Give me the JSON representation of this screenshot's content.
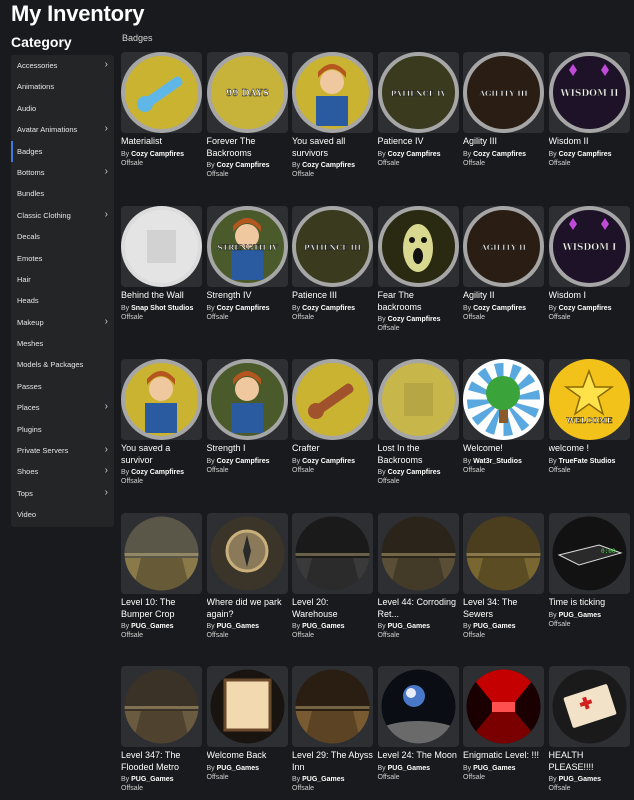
{
  "page": {
    "title": "My Inventory",
    "category_heading": "Category",
    "section_label": "Badges"
  },
  "categories": [
    {
      "label": "Accessories",
      "chevron": true
    },
    {
      "label": "Animations",
      "chevron": false
    },
    {
      "label": "Audio",
      "chevron": false
    },
    {
      "label": "Avatar Animations",
      "chevron": true
    },
    {
      "label": "Badges",
      "chevron": false,
      "active": true
    },
    {
      "label": "Bottoms",
      "chevron": true
    },
    {
      "label": "Bundles",
      "chevron": false
    },
    {
      "label": "Classic Clothing",
      "chevron": true
    },
    {
      "label": "Decals",
      "chevron": false
    },
    {
      "label": "Emotes",
      "chevron": false
    },
    {
      "label": "Hair",
      "chevron": false
    },
    {
      "label": "Heads",
      "chevron": false
    },
    {
      "label": "Makeup",
      "chevron": true
    },
    {
      "label": "Meshes",
      "chevron": false
    },
    {
      "label": "Models & Packages",
      "chevron": false
    },
    {
      "label": "Passes",
      "chevron": false
    },
    {
      "label": "Places",
      "chevron": true
    },
    {
      "label": "Plugins",
      "chevron": false
    },
    {
      "label": "Private Servers",
      "chevron": true
    },
    {
      "label": "Shoes",
      "chevron": true
    },
    {
      "label": "Tops",
      "chevron": true
    },
    {
      "label": "Video",
      "chevron": false
    }
  ],
  "labels": {
    "by_prefix": "By",
    "chevron_glyph": "›"
  },
  "badges": [
    {
      "name": "Materialist",
      "creator": "Cozy Campfires",
      "status": "Offsale",
      "icon": "wrench-badge-icon",
      "art": {
        "type": "wrench",
        "ring": "#a6a6a6"
      }
    },
    {
      "name": "Forever The Backrooms",
      "creator": "Cozy Campfires",
      "status": "Offsale",
      "icon": "99-days-badge-icon",
      "art": {
        "type": "text",
        "text": "99 DAYS",
        "bg": "#c7b23a",
        "ring": "#a6a6a6"
      }
    },
    {
      "name": "You saved all survivors",
      "creator": "Cozy Campfires",
      "status": "Offsale",
      "icon": "survivor-badge-icon",
      "art": {
        "type": "avatar",
        "bg": "#c9b331",
        "ring": "#a6a6a6"
      }
    },
    {
      "name": "Patience IV",
      "creator": "Cozy Campfires",
      "status": "Offsale",
      "icon": "patience-badge-icon",
      "art": {
        "type": "text",
        "text": "PATIENCE IV",
        "bg": "#3a3a1e",
        "ring": "#a6a6a6"
      }
    },
    {
      "name": "Agility III",
      "creator": "Cozy Campfires",
      "status": "Offsale",
      "icon": "agility-badge-icon",
      "art": {
        "type": "text",
        "text": "AGILITY III",
        "bg": "#2a1e14",
        "ring": "#a6a6a6"
      }
    },
    {
      "name": "Wisdom II",
      "creator": "Cozy Campfires",
      "status": "Offsale",
      "icon": "wisdom-badge-icon",
      "art": {
        "type": "text",
        "text": "WISDOM II",
        "bg": "#1e1228",
        "ring": "#a6a6a6",
        "gems": true
      }
    },
    {
      "name": "Behind the Wall",
      "creator": "Snap Shot Studios",
      "status": "Offsale",
      "icon": "wall-badge-icon",
      "art": {
        "type": "plain",
        "bg": "#e4e4e4",
        "ring": "#dcdcdc"
      }
    },
    {
      "name": "Strength IV",
      "creator": "Cozy Campfires",
      "status": "Offsale",
      "icon": "strength-badge-icon",
      "art": {
        "type": "avatartext",
        "text": "STRENGTH IV",
        "bg": "#4a5a2a",
        "ring": "#a6a6a6"
      }
    },
    {
      "name": "Patience III",
      "creator": "Cozy Campfires",
      "status": "Offsale",
      "icon": "patience-badge-icon",
      "art": {
        "type": "text",
        "text": "PATIENCE III",
        "bg": "#3a3a1e",
        "ring": "#a6a6a6"
      }
    },
    {
      "name": "Fear The backrooms",
      "creator": "Cozy Campfires",
      "status": "Offsale",
      "icon": "monster-badge-icon",
      "art": {
        "type": "monster",
        "bg": "#2a2a12",
        "ring": "#a6a6a6"
      }
    },
    {
      "name": "Agility II",
      "creator": "Cozy Campfires",
      "status": "Offsale",
      "icon": "agility-badge-icon",
      "art": {
        "type": "text",
        "text": "AGILITY II",
        "bg": "#2a1e14",
        "ring": "#a6a6a6"
      }
    },
    {
      "name": "Wisdom I",
      "creator": "Cozy Campfires",
      "status": "Offsale",
      "icon": "wisdom-badge-icon",
      "art": {
        "type": "text",
        "text": "WISDOM I",
        "bg": "#1e1228",
        "ring": "#a6a6a6",
        "gems": true
      }
    },
    {
      "name": "You saved a survivor",
      "creator": "Cozy Campfires",
      "status": "Offsale",
      "icon": "survivor-badge-icon",
      "art": {
        "type": "avatar",
        "bg": "#c9b331",
        "ring": "#a6a6a6"
      }
    },
    {
      "name": "Strength I",
      "creator": "Cozy Campfires",
      "status": "Offsale",
      "icon": "strength-badge-icon",
      "art": {
        "type": "avatar",
        "bg": "#4a5a2a",
        "ring": "#a6a6a6"
      }
    },
    {
      "name": "Crafter",
      "creator": "Cozy Campfires",
      "status": "Offsale",
      "icon": "crafter-badge-icon",
      "art": {
        "type": "wrench",
        "bg": "#c9b331",
        "ring": "#a6a6a6",
        "tool": "#a0522d"
      }
    },
    {
      "name": "Lost In the Backrooms",
      "creator": "Cozy Campfires",
      "status": "Offsale",
      "icon": "backrooms-badge-icon",
      "art": {
        "type": "plain",
        "bg": "#c7b64a",
        "ring": "#a6a6a6"
      }
    },
    {
      "name": "Welcome!",
      "creator": "Wat3r_Studios",
      "status": "Offsale",
      "icon": "tree-badge-icon",
      "art": {
        "type": "tree",
        "bg": "#5aa8e0",
        "ring": "#ffffff"
      }
    },
    {
      "name": "welcome !",
      "creator": "TrueFate Studios",
      "status": "Offsale",
      "icon": "star-badge-icon",
      "art": {
        "type": "star",
        "text": "WELCOME",
        "bg": "#f2c21b",
        "ring": "#f2c21b"
      }
    },
    {
      "name": "Level 10: The Bumper Crop",
      "creator": "PUG_Games",
      "status": "Offsale",
      "icon": "field-badge-icon",
      "art": {
        "type": "scene",
        "sky": "#5a5648",
        "ground": "#8a7a4a"
      }
    },
    {
      "name": "Where did we park again?",
      "creator": "PUG_Games",
      "status": "Offsale",
      "icon": "compass-badge-icon",
      "art": {
        "type": "compass",
        "bg": "#3a3528"
      }
    },
    {
      "name": "Level 20: Warehouse",
      "creator": "PUG_Games",
      "status": "Offsale",
      "icon": "warehouse-badge-icon",
      "art": {
        "type": "scene",
        "sky": "#1a1a1a",
        "ground": "#3a3a3a"
      }
    },
    {
      "name": "Level 44: Corroding Ret...",
      "creator": "PUG_Games",
      "status": "Offsale",
      "icon": "hall-badge-icon",
      "art": {
        "type": "scene",
        "sky": "#2a241a",
        "ground": "#5a4e36"
      }
    },
    {
      "name": "Level 34: The Sewers",
      "creator": "PUG_Games",
      "status": "Offsale",
      "icon": "sewer-badge-icon",
      "art": {
        "type": "scene",
        "sky": "#4a3e1e",
        "ground": "#7a6630"
      }
    },
    {
      "name": "Time is ticking",
      "creator": "PUG_Games",
      "status": "Offsale",
      "icon": "clock-badge-icon",
      "art": {
        "type": "timer",
        "bg": "#121212"
      }
    },
    {
      "name": "Level 347: The Flooded Metro",
      "creator": "PUG_Games",
      "status": "Offsale",
      "icon": "metro-badge-icon",
      "art": {
        "type": "scene",
        "sky": "#3a3226",
        "ground": "#6a5a40"
      }
    },
    {
      "name": "Welcome Back",
      "creator": "PUG_Games",
      "status": "Offsale",
      "icon": "doorway-badge-icon",
      "art": {
        "type": "door",
        "bg": "#1a1410"
      }
    },
    {
      "name": "Level 29: The Abyss Inn",
      "creator": "PUG_Games",
      "status": "Offsale",
      "icon": "inn-badge-icon",
      "art": {
        "type": "scene",
        "sky": "#2a1e12",
        "ground": "#7a5a30"
      }
    },
    {
      "name": "Level 24: The Moon",
      "creator": "PUG_Games",
      "status": "Offsale",
      "icon": "moon-badge-icon",
      "art": {
        "type": "moon",
        "bg": "#0a0d14"
      }
    },
    {
      "name": "Enigmatic Level: !!!",
      "creator": "PUG_Games",
      "status": "Offsale",
      "icon": "red-hall-badge-icon",
      "art": {
        "type": "redhall",
        "bg": "#8a0000"
      }
    },
    {
      "name": "HEALTH PLEASE!!!!",
      "creator": "PUG_Games",
      "status": "Offsale",
      "icon": "first-aid-badge-icon",
      "art": {
        "type": "firstaid",
        "bg": "#1a1a1a"
      }
    }
  ]
}
